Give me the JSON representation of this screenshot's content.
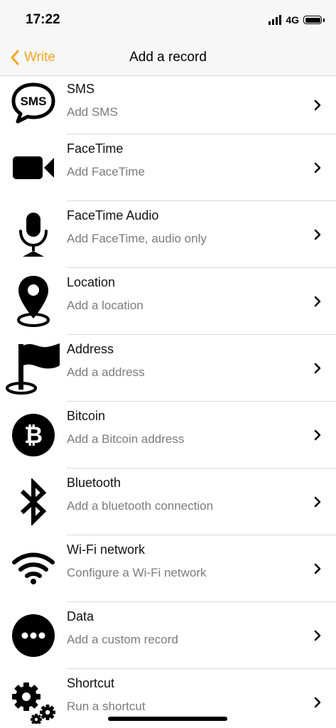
{
  "status": {
    "time": "17:22",
    "network": "4G"
  },
  "nav": {
    "back_label": "Write",
    "title": "Add a record"
  },
  "records": [
    {
      "title": "SMS",
      "subtitle": "Add SMS",
      "icon": "sms-icon"
    },
    {
      "title": "FaceTime",
      "subtitle": "Add FaceTime",
      "icon": "video-camera-icon"
    },
    {
      "title": "FaceTime Audio",
      "subtitle": "Add FaceTime, audio only",
      "icon": "microphone-icon"
    },
    {
      "title": "Location",
      "subtitle": "Add a location",
      "icon": "location-pin-icon"
    },
    {
      "title": "Address",
      "subtitle": "Add a address",
      "icon": "flag-icon"
    },
    {
      "title": "Bitcoin",
      "subtitle": "Add a Bitcoin address",
      "icon": "bitcoin-icon"
    },
    {
      "title": "Bluetooth",
      "subtitle": "Add a bluetooth connection",
      "icon": "bluetooth-icon"
    },
    {
      "title": "Wi-Fi network",
      "subtitle": "Configure a Wi-Fi network",
      "icon": "wifi-icon"
    },
    {
      "title": "Data",
      "subtitle": "Add a custom record",
      "icon": "more-dots-icon"
    },
    {
      "title": "Shortcut",
      "subtitle": "Run a shortcut",
      "icon": "gears-icon"
    }
  ],
  "colors": {
    "accent": "#f5a623",
    "subtitle": "#7b7b7b",
    "separator": "#d9d9d9"
  }
}
